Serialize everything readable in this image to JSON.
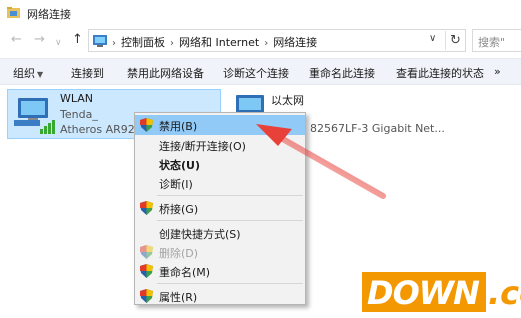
{
  "window": {
    "title": "网络连接"
  },
  "address": {
    "crumbs": [
      "控制面板",
      "网络和 Internet",
      "网络连接"
    ],
    "search_placeholder": "搜索\""
  },
  "toolbar": {
    "items": [
      "组织",
      "连接到",
      "禁用此网络设备",
      "诊断这个连接",
      "重命名此连接",
      "查看此连接的状态",
      "»"
    ]
  },
  "adapters": [
    {
      "name": "WLAN",
      "line2": "Tenda_",
      "line3": "Atheros AR927"
    },
    {
      "name": "以太网",
      "line2": "",
      "line3": "82567LF-3 Gigabit Net..."
    }
  ],
  "context_menu": {
    "items": [
      {
        "label": "禁用(B)",
        "shield": true,
        "highlighted": true
      },
      {
        "label": "连接/断开连接(O)"
      },
      {
        "label": "状态(U)",
        "bold": true
      },
      {
        "label": "诊断(I)"
      },
      {
        "label": "桥接(G)",
        "shield": true
      },
      {
        "label": "创建快捷方式(S)"
      },
      {
        "label": "删除(D)",
        "shield": true,
        "disabled": true
      },
      {
        "label": "重命名(M)",
        "shield": true
      },
      {
        "label": "属性(R)",
        "shield": true
      }
    ]
  },
  "watermark": {
    "main": "DOWN",
    "suffix": ".cc"
  },
  "colors": {
    "selection": "#cce8ff",
    "menu_highlight": "#91c9f7",
    "arrow": "#e8413a",
    "watermark": "#f39800"
  }
}
